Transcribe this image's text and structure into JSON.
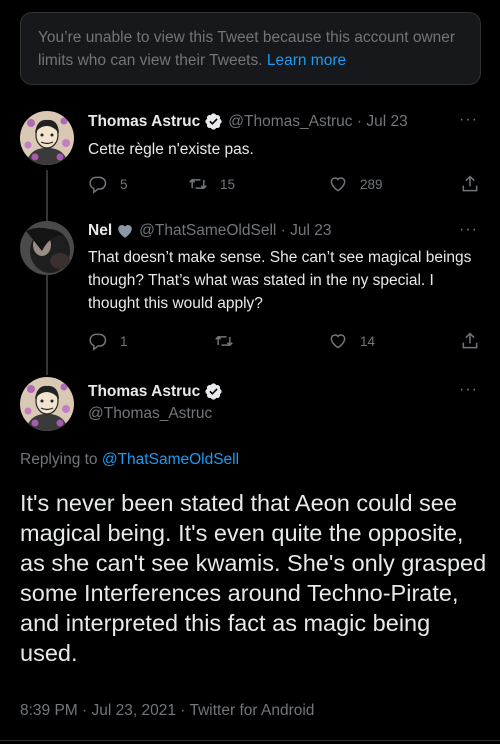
{
  "notice": {
    "text": "You’re unable to view this Tweet because this account owner limits who can view their Tweets.",
    "link": "Learn more"
  },
  "tweet1": {
    "name": "Thomas Astruc",
    "handle": "@Thomas_Astruc",
    "date": "Jul 23",
    "text": "Cette règle n'existe pas.",
    "replies": "5",
    "retweets": "15",
    "likes": "289"
  },
  "tweet2": {
    "name": "Nel",
    "handle": "@ThatSameOldSell",
    "date": "Jul 23",
    "text": "That doesn’t make sense. She can’t see magical beings though? That’s what was stated in the ny special. I thought this would apply?",
    "replies": "1",
    "likes": "14"
  },
  "main_tweet": {
    "name": "Thomas Astruc",
    "handle": "@Thomas_Astruc",
    "replying_prefix": "Replying to",
    "replying_to": "@ThatSameOldSell",
    "text": "It's never been stated that Aeon could see magical being. It's even quite the opposite, as she can't see kwamis. She's only grasped some Interferences around Techno-Pirate, and interpreted this fact as magic being used.",
    "time": "8:39 PM",
    "date": "Jul 23, 2021",
    "client": "Twitter for Android"
  },
  "colors": {
    "background": "#000000",
    "link": "#1d9bf0",
    "secondary": "#71767b",
    "verified": "#e7e9ea"
  },
  "icons": [
    "verified-badge-icon",
    "heart-badge-icon",
    "more-icon",
    "reply-icon",
    "retweet-icon",
    "like-icon",
    "share-icon"
  ]
}
